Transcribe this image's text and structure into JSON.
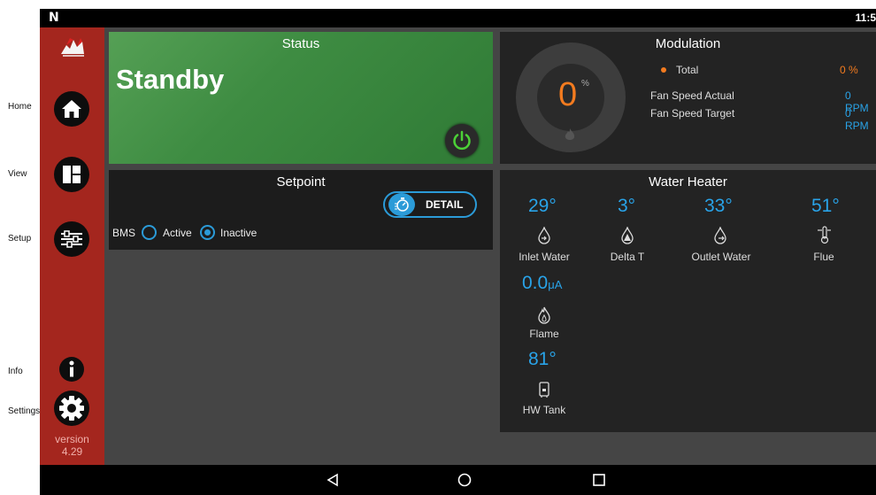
{
  "external_labels": {
    "home": "Home",
    "view": "View",
    "setup": "Setup",
    "info": "Info",
    "settings": "Settings"
  },
  "statusbar": {
    "logo": "N",
    "clock": "11:5"
  },
  "sidebar": {
    "version_label": "version",
    "version_number": "4.29"
  },
  "status": {
    "title": "Status",
    "value": "Standby"
  },
  "modulation": {
    "title": "Modulation",
    "gauge_value": "0",
    "gauge_unit": "%",
    "rows": [
      {
        "label": "Total",
        "value": "0 %"
      },
      {
        "label": "Fan Speed Actual",
        "value": "0 RPM"
      },
      {
        "label": "Fan Speed Target",
        "value": "0 RPM"
      }
    ]
  },
  "setpoint": {
    "title": "Setpoint",
    "detail_label": "DETAIL",
    "bms_label": "BMS",
    "active_label": "Active",
    "inactive_label": "Inactive",
    "selected": "Inactive"
  },
  "water_heater": {
    "title": "Water Heater",
    "items": [
      {
        "value": "29°",
        "label": "Inlet Water",
        "icon": "water-drop-in-icon"
      },
      {
        "value": "3°",
        "label": "Delta T",
        "icon": "delta-drop-icon"
      },
      {
        "value": "33°",
        "label": "Outlet Water",
        "icon": "water-drop-out-icon"
      },
      {
        "value": "51°",
        "label": "Flue",
        "icon": "flue-thermometer-icon"
      },
      {
        "value": "0.0",
        "unit": "μA",
        "label": "Flame",
        "icon": "flame-icon"
      },
      {
        "value": "81°",
        "label": "HW Tank",
        "icon": "tank-icon"
      }
    ]
  },
  "colors": {
    "sidebar": "#a4261e",
    "accent_blue": "#29a3e8",
    "accent_orange": "#f37b1f",
    "power_green": "#4cd137"
  }
}
